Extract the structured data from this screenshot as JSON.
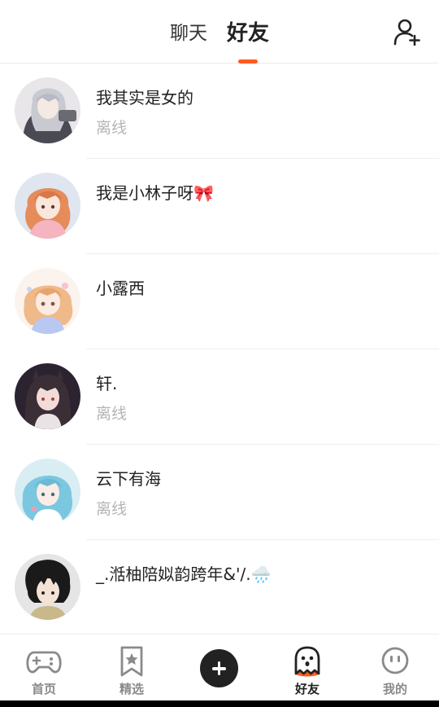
{
  "header": {
    "tabs": [
      {
        "label": "聊天",
        "active": false
      },
      {
        "label": "好友",
        "active": true
      }
    ],
    "add_friend_icon": "add-user-icon",
    "accent_color": "#ff5a1f"
  },
  "friends": [
    {
      "name": "我其实是女的",
      "status": "离线"
    },
    {
      "name": "我是小林子呀🎀",
      "status": ""
    },
    {
      "name": "小露西",
      "status": ""
    },
    {
      "name": "轩.",
      "status": "离线"
    },
    {
      "name": "云下有海",
      "status": "离线"
    },
    {
      "name": "_.湉柚陪姒韵跨年&'/.🌧️",
      "status": ""
    }
  ],
  "bottom_nav": {
    "items": [
      {
        "label": "首页",
        "icon": "gamepad-icon"
      },
      {
        "label": "精选",
        "icon": "star-bookmark-icon"
      },
      {
        "label": "",
        "icon": "plus-icon"
      },
      {
        "label": "好友",
        "icon": "ghost-icon",
        "active": true
      },
      {
        "label": "我的",
        "icon": "face-icon"
      }
    ]
  }
}
